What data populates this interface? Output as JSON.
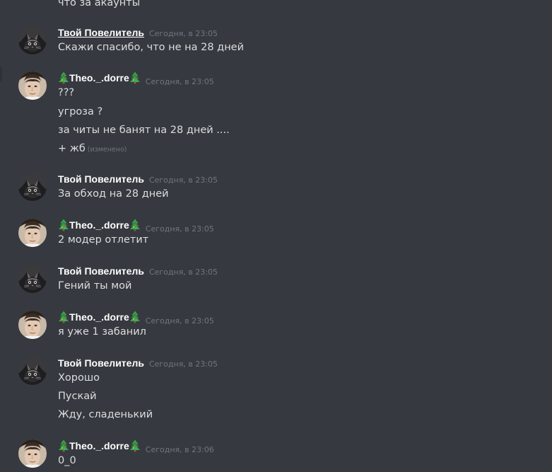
{
  "colors": {
    "background": "#36393f",
    "username": "#ffffff",
    "message_text": "#dcddde",
    "timestamp": "#72767d"
  },
  "users": {
    "povelitel": "Твой Повелитель",
    "theo": "Theo._.dorre"
  },
  "top_partial_message": "что за акаунты",
  "groups": [
    {
      "author": "Твой Повелитель",
      "timestamp": "Сегодня, в 23:05",
      "messages": [
        "Скажи спасибо, что не на 28 дней"
      ]
    },
    {
      "author": "Theo._.dorre",
      "timestamp": "Сегодня, в 23:05",
      "messages": [
        "???",
        "угроза ?",
        "за читы не банят на 28 дней ....",
        "+ жб"
      ],
      "edited_label": "(изменено)"
    },
    {
      "author": "Твой Повелитель",
      "timestamp": "Сегодня, в 23:05",
      "messages": [
        "За обход на 28 дней"
      ]
    },
    {
      "author": "Theo._.dorre",
      "timestamp": "Сегодня, в 23:05",
      "messages": [
        "2 модер отлетит"
      ]
    },
    {
      "author": "Твой Повелитель",
      "timestamp": "Сегодня, в 23:05",
      "messages": [
        "Гений ты мой"
      ]
    },
    {
      "author": "Theo._.dorre",
      "timestamp": "Сегодня, в 23:05",
      "messages": [
        "я уже 1 забанил"
      ]
    },
    {
      "author": "Твой Повелитель",
      "timestamp": "Сегодня, в 23:05",
      "messages": [
        "Хорошо",
        "Пускай",
        "Жду, сладенький"
      ]
    },
    {
      "author": "Theo._.dorre",
      "timestamp": "Сегодня, в 23:06",
      "messages": [
        "0_0"
      ]
    }
  ]
}
